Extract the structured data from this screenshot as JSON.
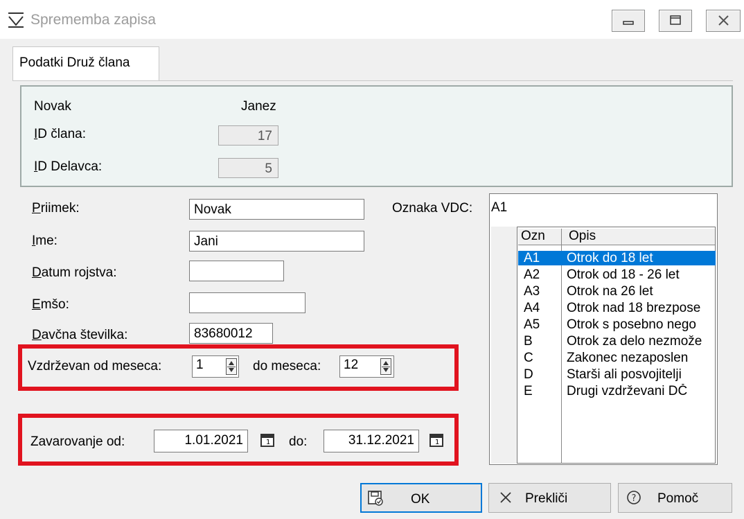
{
  "window": {
    "title": "Sprememba zapisa",
    "icon": "funnel-icon"
  },
  "tabs": [
    {
      "label": "Podatki Druž člana",
      "active": true
    }
  ],
  "info": {
    "surname": "Novak",
    "name": "Janez",
    "member_id_label_prefix": "I",
    "member_id_label_rest": "D člana:",
    "member_id": "17",
    "worker_id_label_prefix": "I",
    "worker_id_label_rest": "D Delavca:",
    "worker_id": "5"
  },
  "form": {
    "surname_label_prefix": "P",
    "surname_label_rest": "riimek:",
    "surname_value": "Novak",
    "name_label_prefix": "I",
    "name_label_rest": "me:",
    "name_value": "Jani",
    "birth_label_prefix": "D",
    "birth_label_rest": "atum rojstva:",
    "birth_value": "",
    "emso_label_prefix": "E",
    "emso_label_rest": "mšo:",
    "emso_value": "",
    "tax_label_prefix": "D",
    "tax_label_rest": "avčna številka:",
    "tax_value": "83680012"
  },
  "months": {
    "from_label": "Vzdrževan od meseca:",
    "from_value": "1",
    "to_label": "do meseca:",
    "to_value": "12"
  },
  "insurance": {
    "from_label": "Zavarovanje od:",
    "from_value": "1.01.2021",
    "to_label": "do:",
    "to_value": "31.12.2021"
  },
  "vdc": {
    "label": "Oznaka VDC:",
    "value": "A1",
    "columns": [
      "Ozn",
      "Opis"
    ],
    "rows": [
      {
        "code": "A1",
        "desc": "Otrok do 18 let",
        "selected": true
      },
      {
        "code": "A2",
        "desc": "Otrok od 18 - 26 let"
      },
      {
        "code": "A3",
        "desc": "Otrok na 26 let"
      },
      {
        "code": "A4",
        "desc": "Otrok nad 18 brezpose"
      },
      {
        "code": "A5",
        "desc": "Otrok s posebno nego"
      },
      {
        "code": "B",
        "desc": "Otrok za delo nezmože"
      },
      {
        "code": "C",
        "desc": "Zakonec nezaposlen"
      },
      {
        "code": "D",
        "desc": "Starši ali posvojitelji"
      },
      {
        "code": "E",
        "desc": "Drugi vzdrževani DČ"
      }
    ]
  },
  "buttons": {
    "ok": "OK",
    "cancel": "Prekliči",
    "help": "Pomoč"
  },
  "colors": {
    "highlight": "#e1131f",
    "selection": "#0078d7"
  }
}
